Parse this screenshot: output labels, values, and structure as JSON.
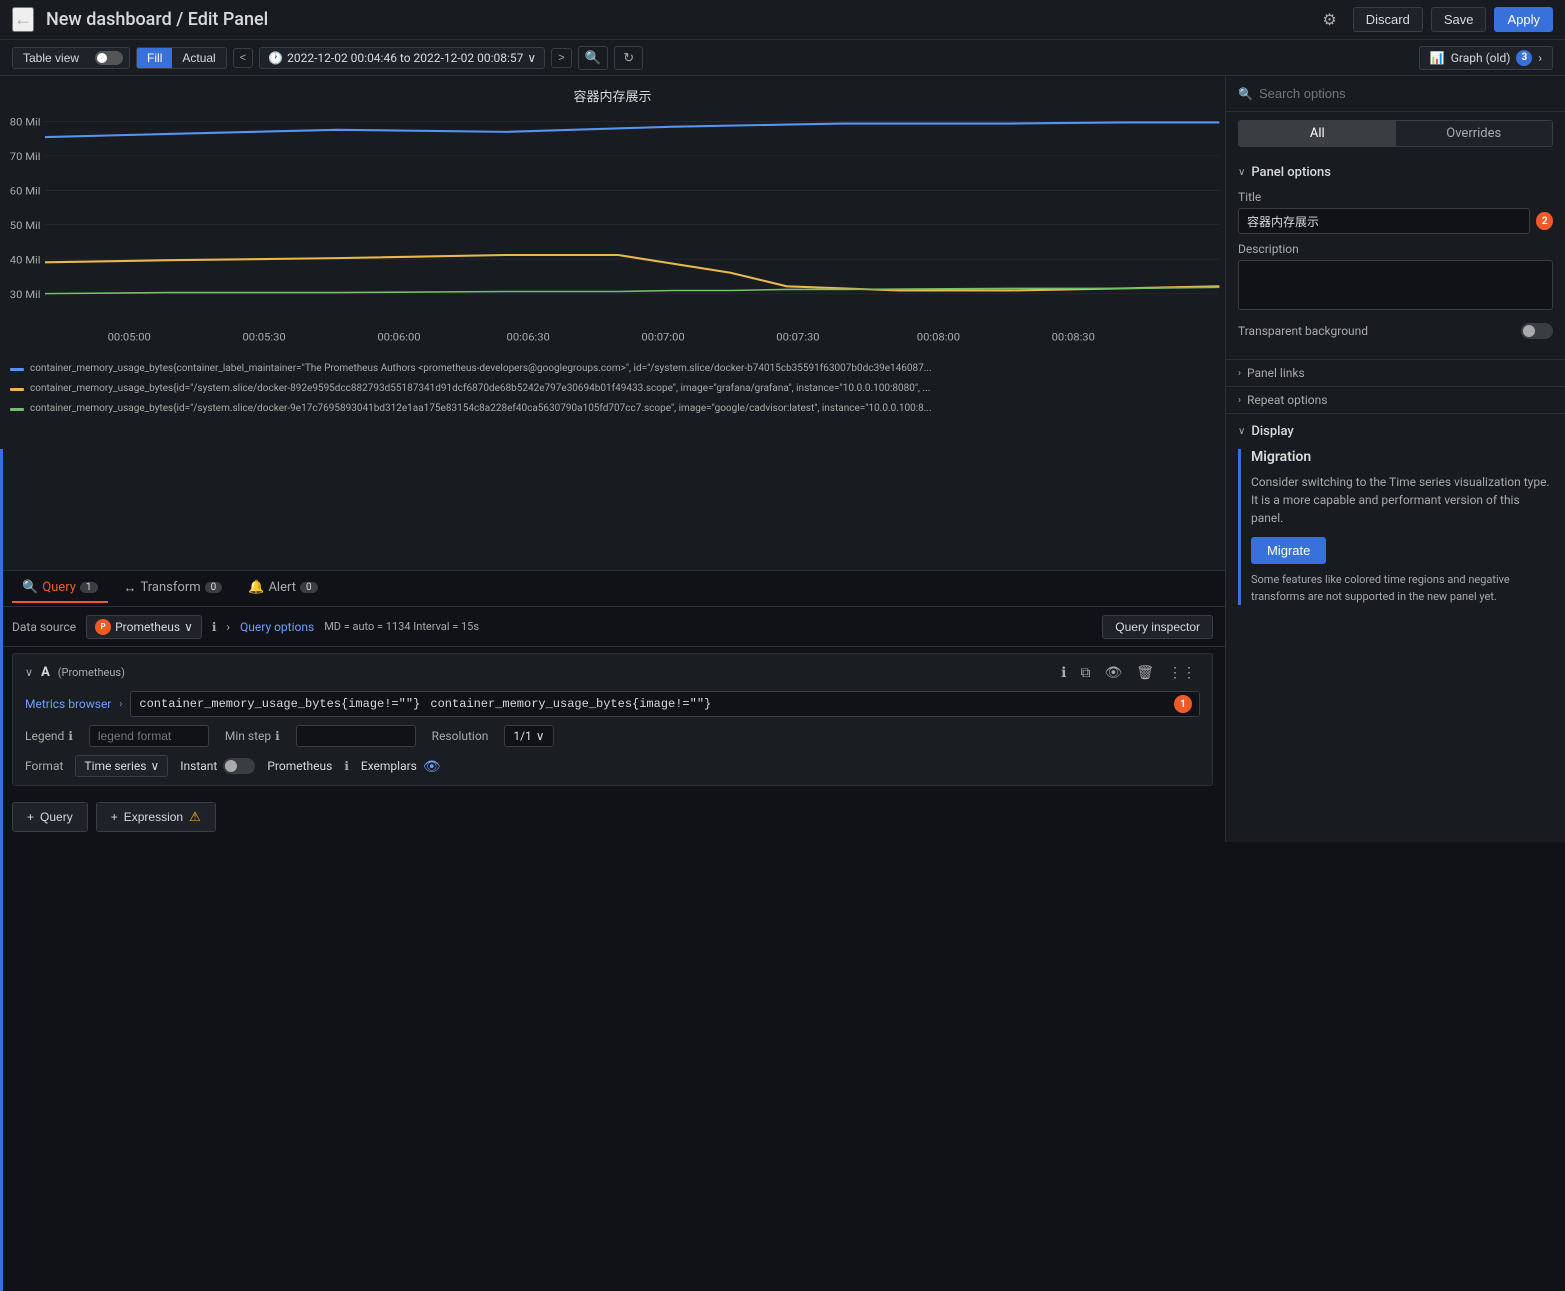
{
  "header": {
    "back_icon": "←",
    "title": "New dashboard / Edit Panel",
    "settings_icon": "⚙",
    "discard_label": "Discard",
    "save_label": "Save",
    "apply_label": "Apply"
  },
  "toolbar": {
    "table_view_label": "Table view",
    "fill_label": "Fill",
    "actual_label": "Actual",
    "nav_prev": "<",
    "nav_next": ">",
    "time_icon": "🕐",
    "time_range": "2022-12-02 00:04:46 to 2022-12-02 00:08:57",
    "time_caret": "∨",
    "zoom_icon": "🔍",
    "refresh_icon": "↻",
    "graph_icon": "📊",
    "graph_type": "Graph (old)",
    "graph_badge": "3",
    "graph_arrow": ">"
  },
  "chart": {
    "title": "容器内存展示",
    "y_labels": [
      "80 Mil",
      "70 Mil",
      "60 Mil",
      "50 Mil",
      "40 Mil",
      "30 Mil"
    ],
    "x_labels": [
      "00:05:00",
      "00:05:30",
      "00:06:00",
      "00:06:30",
      "00:07:00",
      "00:07:30",
      "00:08:00",
      "00:08:30"
    ],
    "legend": [
      {
        "color": "#5794f2",
        "text": "container_memory_usage_bytes{container_label_maintainer=\"The Prometheus Authors <prometheus-developers@googlegroups.com>\", id=\"/system.slice/docker-b74015cb35591f63007b0dc39e146087..."
      },
      {
        "color": "#e8b84d",
        "text": "container_memory_usage_bytes{id=\"/system.slice/docker-892e9595dcc882793d55187341d91dcf6870de68b5242e797e30694b01f49433.scope\", image=\"grafana/grafana\", instance=\"10.0.0.100:8080\"..."
      },
      {
        "color": "#73bf69",
        "text": "container_memory_usage_bytes{id=\"/system.slice/docker-9e17c7695893041bd312e1aa175e83154c8a228ef40ca5630790a105fd707cc7.scope\", image=\"google/cadvisor:latest\", instance=\"10.0.0.100:8..."
      }
    ]
  },
  "query_panel": {
    "tabs": [
      {
        "label": "Query",
        "badge": "1",
        "icon": "🔍"
      },
      {
        "label": "Transform",
        "badge": "0",
        "icon": "↔"
      },
      {
        "label": "Alert",
        "badge": "0",
        "icon": "🔔"
      }
    ],
    "datasource": {
      "label": "Data source",
      "name": "Prometheus",
      "info_icon": "ℹ",
      "query_options_label": "Query options",
      "query_meta": "MD = auto = 1134  Interval = 15s",
      "query_inspector_label": "Query inspector"
    },
    "query_a": {
      "letter": "A",
      "prom_label": "(Prometheus)",
      "metrics_browser_label": "Metrics browser",
      "arrow": "›",
      "query_text": "container_memory_usage_bytes{image!=\"\"}",
      "badge": "1",
      "autocomplete_hint": "container_memory_usage_bytes{image!=\"\"}",
      "legend_label": "Legend",
      "legend_placeholder": "legend format",
      "min_step_label": "Min step",
      "resolution_label": "Resolution",
      "resolution_value": "1/1",
      "format_label": "Format",
      "format_value": "Time series",
      "instant_label": "Instant",
      "prom_select": "Prometheus",
      "exemplars_label": "Exemplars"
    },
    "add_query_label": "+ Query",
    "add_expression_label": "+ Expression"
  },
  "right_panel": {
    "search_placeholder": "Search options",
    "tabs": [
      "All",
      "Overrides"
    ],
    "panel_options": {
      "header": "Panel options",
      "title_label": "Title",
      "title_value": "容器内存展示",
      "title_badge": "2",
      "description_label": "Description",
      "description_value": "",
      "transparent_bg_label": "Transparent background"
    },
    "panel_links": {
      "header": "Panel links"
    },
    "repeat_options": {
      "header": "Repeat options"
    },
    "display": {
      "header": "Display",
      "migration": {
        "title": "Migration",
        "description": "Consider switching to the Time series visualization type. It is a more capable and performant version of this panel.",
        "button_label": "Migrate",
        "note": "Some features like colored time regions and negative transforms are not supported in the new panel yet."
      }
    }
  }
}
